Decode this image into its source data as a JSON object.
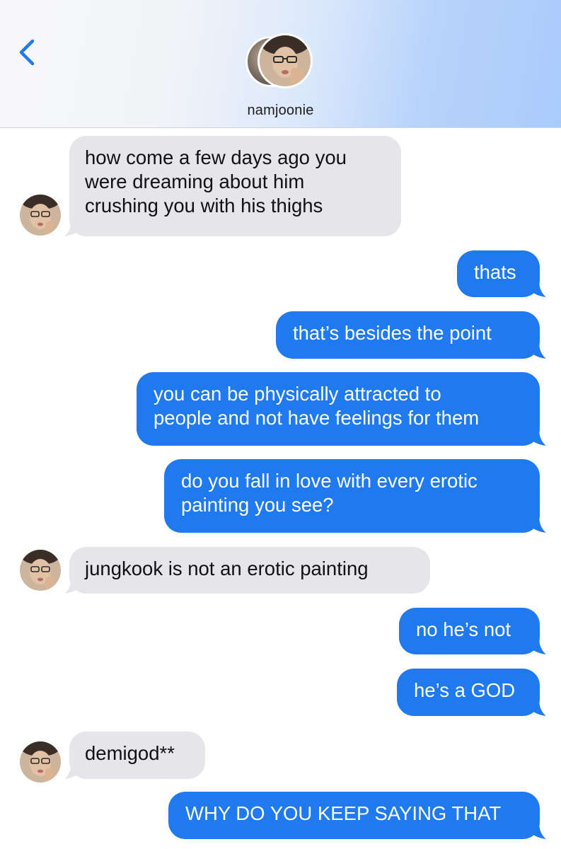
{
  "header": {
    "contact_name": "namjoonie"
  },
  "messages": [
    {
      "from": "them",
      "lines": [
        "how come a few days ago you",
        "were dreaming about him",
        "crushing you with his thighs"
      ]
    },
    {
      "from": "me",
      "lines": [
        "thats"
      ]
    },
    {
      "from": "me",
      "lines": [
        "that’s besides the point"
      ]
    },
    {
      "from": "me",
      "lines": [
        "you can be physically attracted to",
        "people and not have feelings for them"
      ]
    },
    {
      "from": "me",
      "lines": [
        "do you fall in love with every erotic",
        "painting you see?"
      ]
    },
    {
      "from": "them",
      "lines": [
        "jungkook is not an erotic painting"
      ]
    },
    {
      "from": "me",
      "lines": [
        "no he’s not"
      ]
    },
    {
      "from": "me",
      "lines": [
        "he’s a GOD"
      ]
    },
    {
      "from": "them",
      "lines": [
        "demigod**"
      ]
    },
    {
      "from": "me",
      "lines": [
        "WHY DO YOU KEEP SAYING THAT"
      ]
    }
  ],
  "colors": {
    "outgoing_bubble": "#1f7aef",
    "incoming_bubble": "#e5e5ea",
    "back_chevron": "#1f7aef"
  },
  "icons": {
    "back": "chevron-left-icon",
    "contact_avatar": "avatar"
  }
}
